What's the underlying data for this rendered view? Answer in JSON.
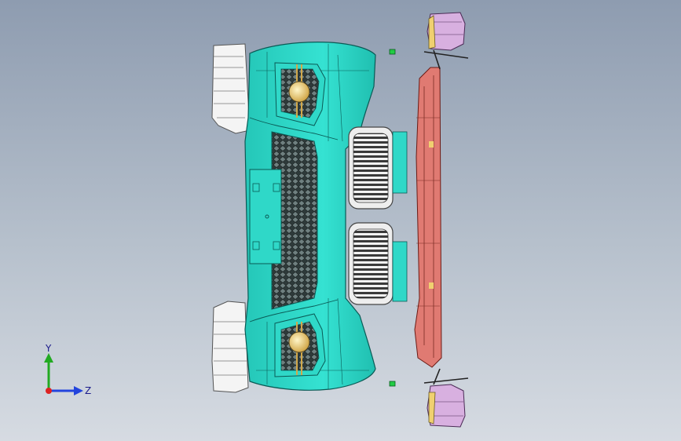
{
  "viewport": {
    "name": "3d-model-viewport",
    "colors": {
      "background_top": "#8e9cb0",
      "background_bottom": "#d6dbe2",
      "bumper": "#2fd8c8",
      "bumper_edge": "#0a5a55",
      "grille_mesh": "#3a4a4a",
      "kidney_grille": "#e6e6e6",
      "reinforcement_beam": "#e07a72",
      "bracket": "#d8b0e0",
      "fog_lamp": "#f0d070",
      "marker": "#22cc44"
    }
  },
  "triad": {
    "y_label": "Y",
    "z_label": "Z",
    "y_color": "#22aa22",
    "z_color": "#2244dd",
    "x_color": "#dd2222"
  }
}
